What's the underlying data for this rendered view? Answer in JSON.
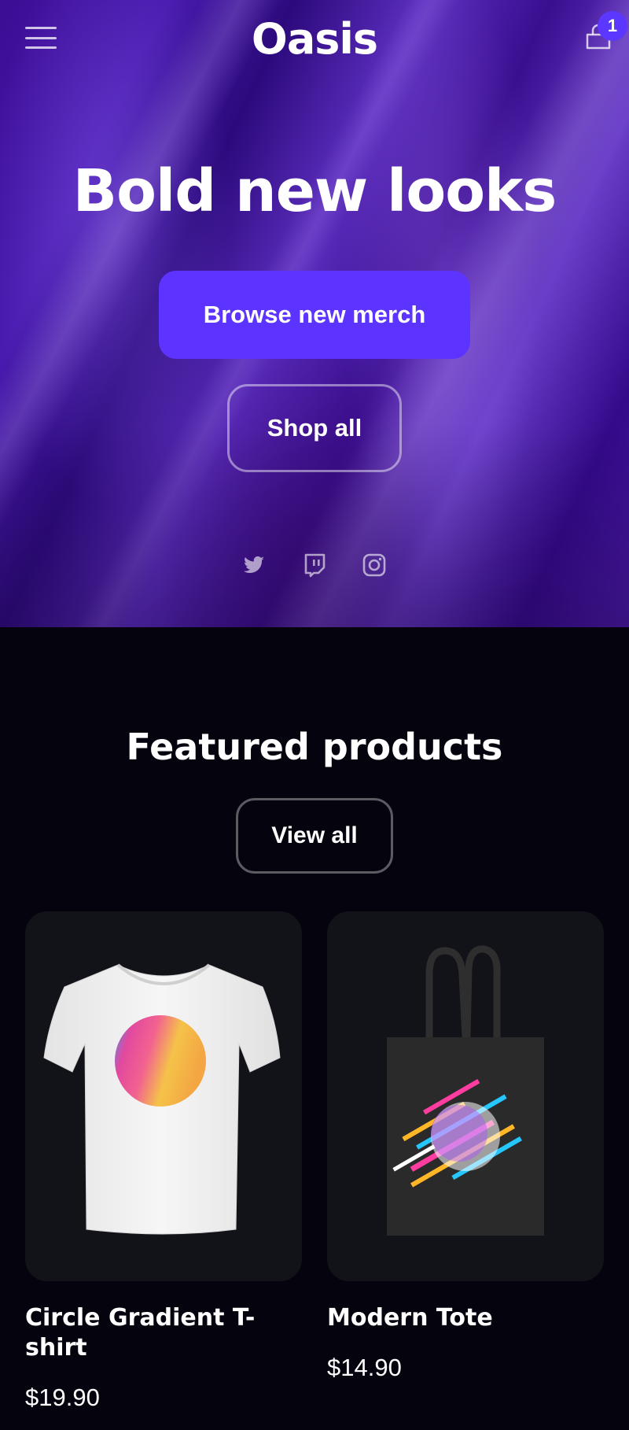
{
  "header": {
    "logo": "Oasis",
    "menu_icon": "hamburger-menu-icon",
    "cart_icon": "shopping-bag-icon",
    "cart_count": "1"
  },
  "hero": {
    "title": "Bold new looks",
    "primary_button": "Browse new merch",
    "secondary_button": "Shop all",
    "socials": [
      {
        "icon": "twitter-icon"
      },
      {
        "icon": "twitch-icon"
      },
      {
        "icon": "instagram-icon"
      }
    ]
  },
  "featured": {
    "title": "Featured products",
    "view_all_label": "View all",
    "products": [
      {
        "name": "Circle Gradient T-shirt",
        "price": "$19.90"
      },
      {
        "name": "Modern Tote",
        "price": "$14.90"
      }
    ]
  },
  "colors": {
    "accent": "#5c33ff",
    "background": "#05040e",
    "card": "#121219"
  }
}
